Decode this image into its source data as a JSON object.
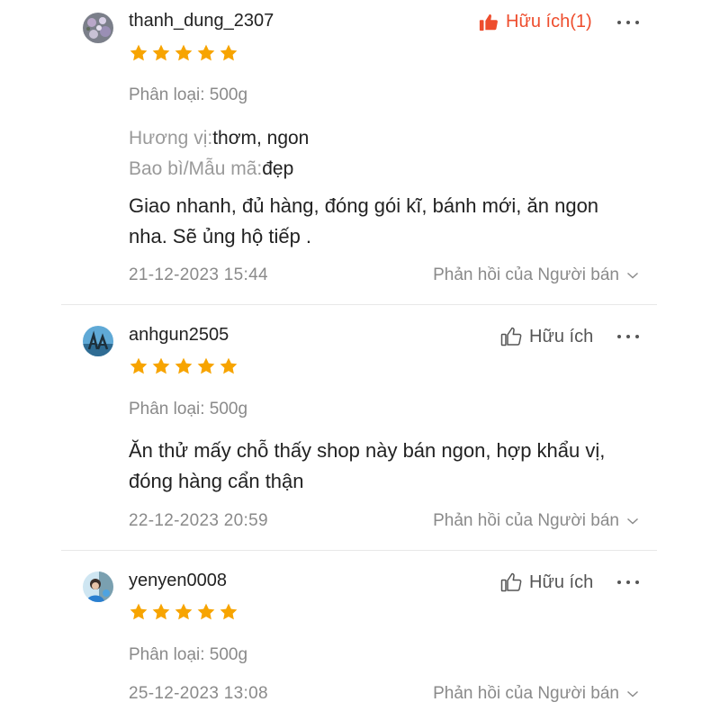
{
  "colors": {
    "accent": "#ee4d2d",
    "star": "#f7a400",
    "muted": "#8a8a8a"
  },
  "reviews": [
    {
      "username": "thanh_dung_2307",
      "helpful_label": "Hữu ích(1)",
      "helpful_active": true,
      "rating": 5,
      "variation": "Phân loại: 500g",
      "flavor_key": "Hương vị:",
      "flavor_value": "thơm, ngon",
      "packaging_key": "Bao bì/Mẫu mã:",
      "packaging_value": "đẹp",
      "comment": "Giao nhanh, đủ hàng, đóng gói kĩ, bánh mới, ăn ngon nha. Sẽ ủng hộ tiếp .",
      "date": "21-12-2023 15:44",
      "reply_label": "Phản hồi của Người bán"
    },
    {
      "username": "anhgun2505",
      "helpful_label": "Hữu ích",
      "helpful_active": false,
      "rating": 5,
      "variation": "Phân loại: 500g",
      "comment": "Ăn thử mấy chỗ thấy shop này bán ngon, hợp khẩu vị, đóng hàng cẩn thận",
      "date": "22-12-2023 20:59",
      "reply_label": "Phản hồi của Người bán"
    },
    {
      "username": "yenyen0008",
      "helpful_label": "Hữu ích",
      "helpful_active": false,
      "rating": 5,
      "variation": "Phân loại: 500g",
      "date": "25-12-2023 13:08",
      "reply_label": "Phản hồi của Người bán"
    }
  ]
}
